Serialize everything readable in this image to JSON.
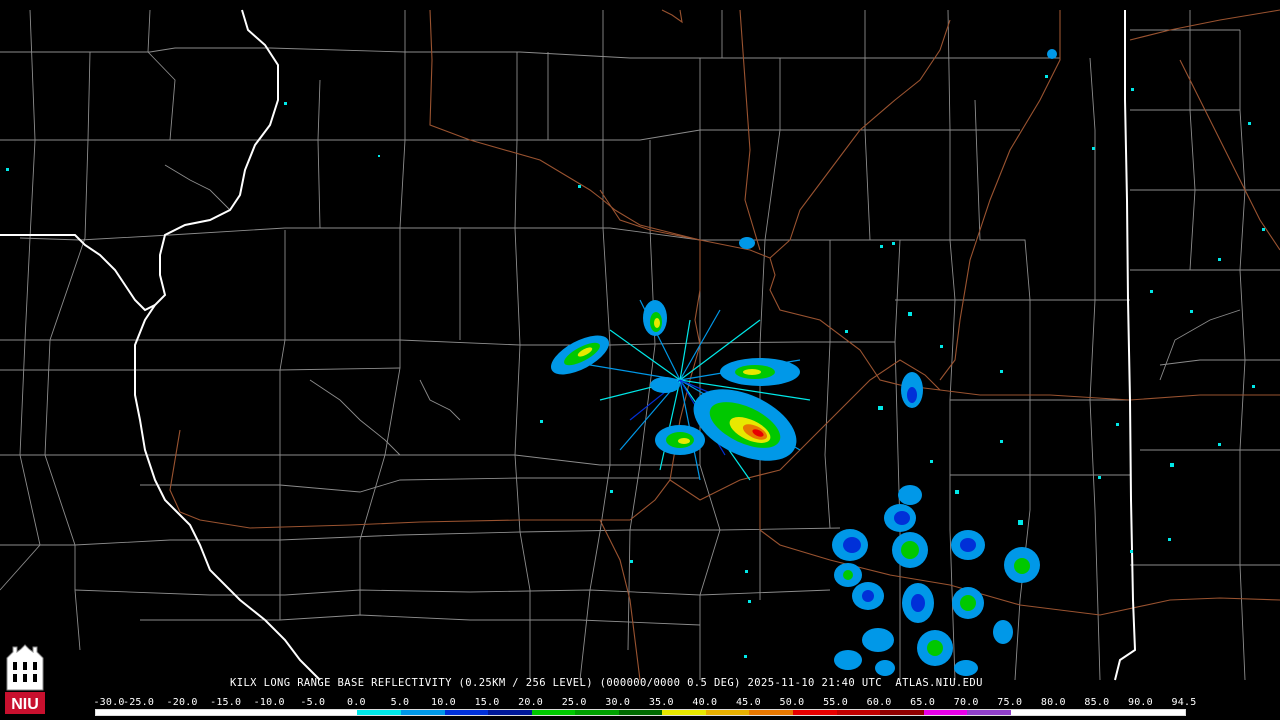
{
  "product": {
    "caption": "KILX LONG RANGE BASE REFLECTIVITY (0.25KM / 256 LEVEL) (000000/0000 0.5 DEG) 2025-11-10 21:40 UTC  ATLAS.NIU.EDU",
    "radar_site": "KILX"
  },
  "logo": {
    "text": "NIU",
    "color": "#c8102e",
    "icon": "university-tower-icon"
  },
  "colors": {
    "background": "#000000",
    "state_border": "#ffffff",
    "county_border": "#8c8c8c",
    "highway": "#9a5330"
  },
  "scale": {
    "labels": [
      "-30.0",
      "-25.0",
      "-20.0",
      "-15.0",
      "-10.0",
      "-5.0",
      "0.0",
      "5.0",
      "10.0",
      "15.0",
      "20.0",
      "25.0",
      "30.0",
      "35.0",
      "40.0",
      "45.0",
      "50.0",
      "55.0",
      "60.0",
      "65.0",
      "70.0",
      "75.0",
      "80.0",
      "85.0",
      "90.0",
      "94.5"
    ],
    "colors": [
      "#ffffff",
      "#ffffff",
      "#ffffff",
      "#ffffff",
      "#ffffff",
      "#ffffff",
      "#00e8e8",
      "#0098e8",
      "#0030d8",
      "#001898",
      "#00c800",
      "#00a000",
      "#006800",
      "#e8e800",
      "#e8b000",
      "#e87800",
      "#e80000",
      "#c00000",
      "#900000",
      "#e800e8",
      "#9040c8",
      "#ffffff",
      "#ffffff",
      "#ffffff",
      "#ffffff"
    ]
  }
}
